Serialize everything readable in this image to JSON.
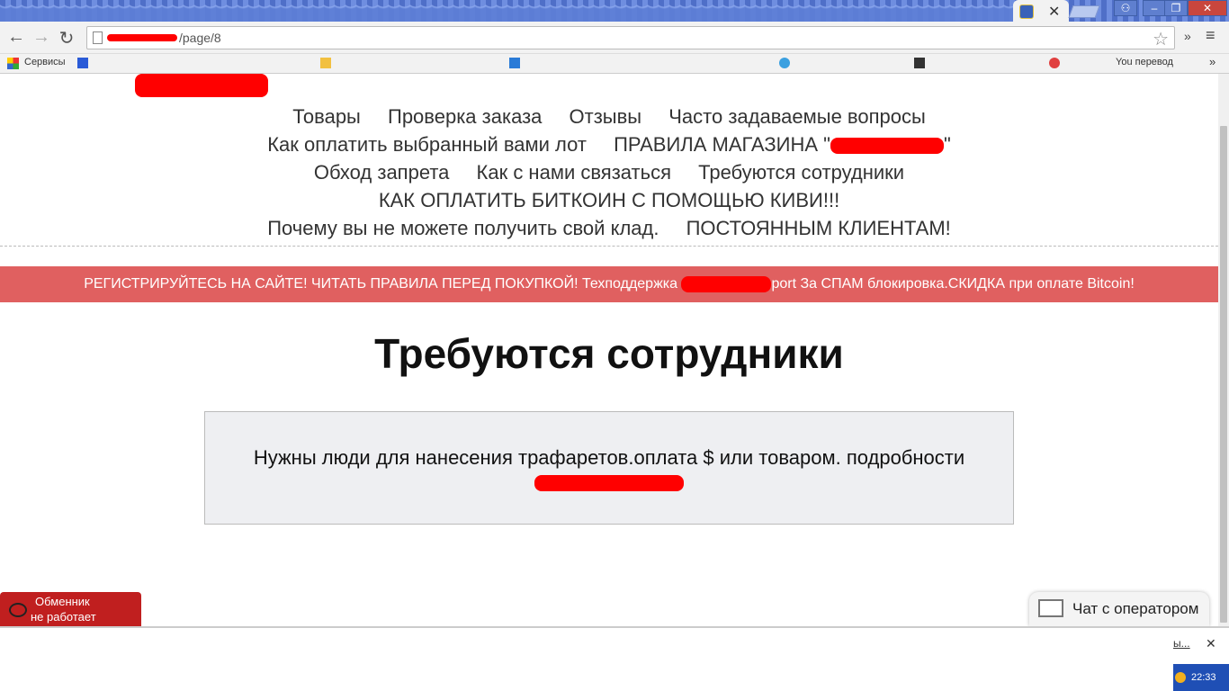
{
  "browser": {
    "url": "/page/8",
    "bookmarks": {
      "apps_label": "Сервисы",
      "last_label": "You перевод"
    },
    "window_controls": {
      "minimize": "–",
      "maximize": "❐",
      "close": "✕"
    }
  },
  "nav": {
    "row1": [
      "Товары",
      "Проверка заказа",
      "Отзывы",
      "Часто задаваемые вопросы"
    ],
    "row2": [
      "Как оплатить выбранный вами лот",
      "ПРАВИЛА МАГАЗИНА \""
    ],
    "row2_suffix": "\"",
    "row3": [
      "Обход запрета",
      "Как с нами связаться",
      "Требуются сотрудники"
    ],
    "row4": [
      "КАК ОПЛАТИТЬ БИТКОИН С ПОМОЩЬЮ КИВИ!!!"
    ],
    "row5": [
      "Почему вы не можете получить свой клад.",
      "ПОСТОЯННЫМ КЛИЕНТАМ!"
    ]
  },
  "banner": {
    "text_before": "РЕГИСТРИРУЙТЕСЬ НА САЙТЕ! ЧИТАТЬ ПРАВИЛА ПЕРЕД ПОКУПКОЙ! Техподдержка",
    "text_after": "port За СПАМ блокировка.СКИДКА при оплате Bitcoin!"
  },
  "main": {
    "title": "Требуются сотрудники",
    "body_line1": "Нужны люди для нанесения трафаретов.оплата $ или товаром. подробности"
  },
  "widgets": {
    "exchanger_line1": "Обменник",
    "exchanger_line2": "не работает",
    "chat_label": "Чат с оператором"
  },
  "bottom": {
    "link": "ы...",
    "close": "✕",
    "clock": "22:33"
  }
}
